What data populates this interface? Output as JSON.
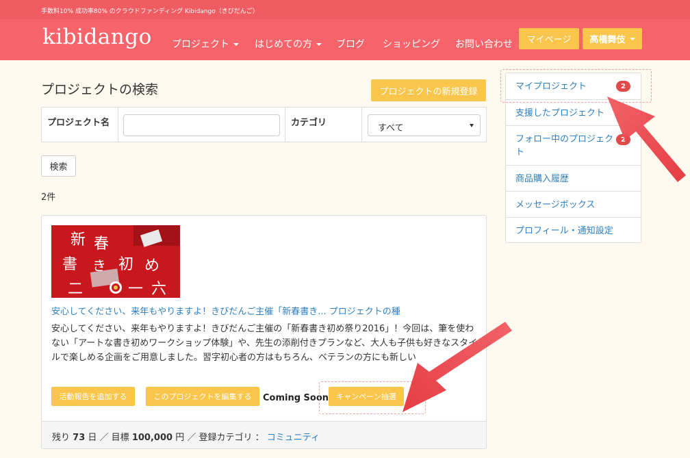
{
  "topbar": {
    "text": "手数料10% 成功率80% のクラウドファンディング Kibidango（きびだんご）"
  },
  "navbar": {
    "logo": "kibidango",
    "items": [
      {
        "label": "プロジェクト",
        "dropdown": true
      },
      {
        "label": "はじめての方",
        "dropdown": true
      },
      {
        "label": "ブログ",
        "dropdown": false
      },
      {
        "label": "ショッピング",
        "dropdown": false
      },
      {
        "label": "お問い合わせ",
        "dropdown": false
      }
    ],
    "mypage_label": "マイページ",
    "user_label": "高橋舞伎"
  },
  "search": {
    "title": "プロジェクトの検索",
    "new_project_label": "プロジェクトの新規登録",
    "name_label": "プロジェクト名",
    "name_value": "",
    "category_label": "カテゴリ",
    "category_value": "すべて",
    "search_button": "検索",
    "result_count": "2件"
  },
  "project": {
    "image_text": [
      "新",
      "春",
      "書",
      "き",
      "初",
      "め",
      "二",
      "〇",
      "一",
      "六"
    ],
    "link_text": "安心してください、来年もやりますよ！きびだんご主催「新春書き...  プロジェクトの種",
    "description": "安心してください、来年もやりますよ！きびだんご主催の「新春書き初め祭り2016」！今回は、筆を使わない「アートな書き初めワークショップ体験」や、先生の添削付きプランなど、大人も子供も好きなスタイルで楽しめる企画をご用意しました。習字初心者の方はもちろん、ベテランの方にも新しい",
    "buttons": {
      "add_report": "活動報告を追加する",
      "edit_project": "このプロジェクトを編集する",
      "coming_soon": "Coming Soon!",
      "campaign": "キャンペーン抽選"
    },
    "footer": {
      "remaining_prefix": "残り",
      "remaining_days": "73",
      "days_unit": "日",
      "goal_prefix": "／ 目標",
      "goal_amount": "100,000",
      "yen_unit": "円",
      "category_prefix": "／ 登録カテゴリ ：",
      "category_name": "コミュニティ"
    }
  },
  "sidebar": {
    "items": [
      {
        "label": "マイプロジェクト",
        "badge": "2"
      },
      {
        "label": "支援したプロジェクト",
        "badge": ""
      },
      {
        "label": "フォロー中のプロジェクト",
        "badge": "2"
      },
      {
        "label": "商品購入履歴",
        "badge": ""
      },
      {
        "label": "メッセージボックス",
        "badge": ""
      },
      {
        "label": "プロフィール・通知設定",
        "badge": ""
      }
    ]
  },
  "colors": {
    "brand_red": "#f6636a",
    "accent_yellow": "#f9c54a",
    "link_blue": "#2d7fc1",
    "badge_red": "#e24a4a",
    "arrow_red": "#e8383e"
  }
}
